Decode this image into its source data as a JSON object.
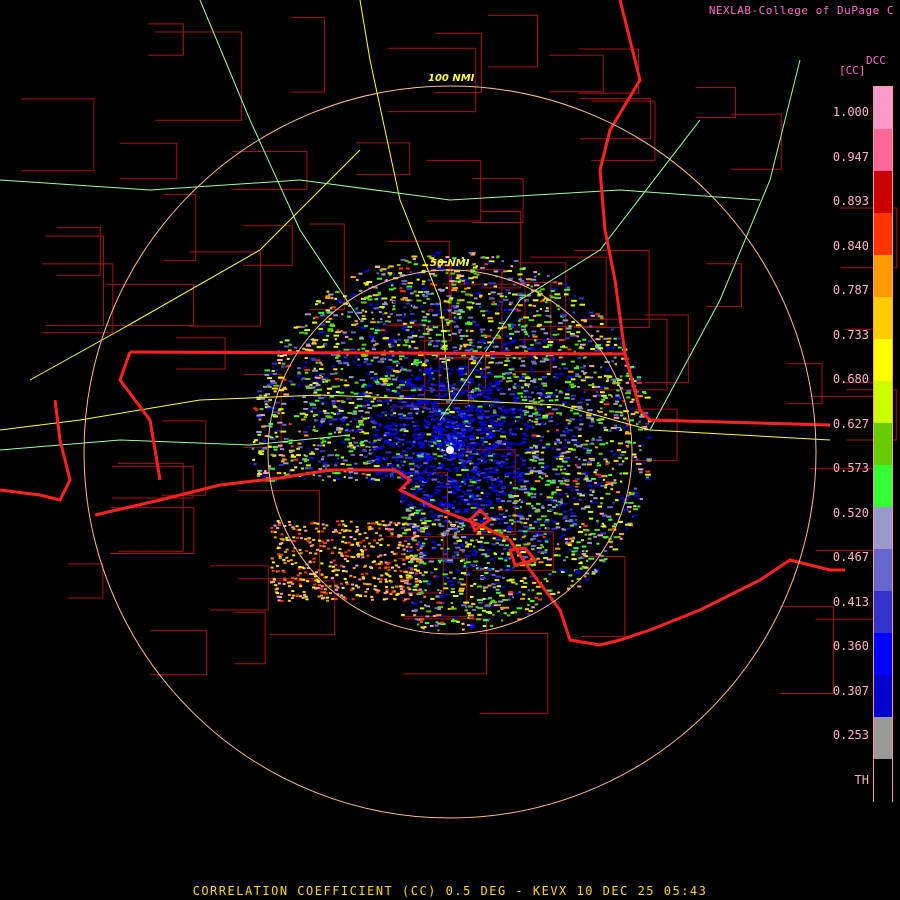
{
  "credit": "NEXLAB-College of DuPage C",
  "legend": {
    "source": "DCC",
    "unit": "[CC]",
    "ticks": [
      "1.000",
      "0.947",
      "0.893",
      "0.840",
      "0.787",
      "0.733",
      "0.680",
      "0.627",
      "0.573",
      "0.520",
      "0.467",
      "0.413",
      "0.360",
      "0.307",
      "0.253",
      "TH"
    ],
    "colors": [
      "#ff99cc",
      "#ff6699",
      "#cc0000",
      "#ff3300",
      "#ff9900",
      "#ffcc00",
      "#ffff00",
      "#ccff00",
      "#66cc00",
      "#33ff33",
      "#9999cc",
      "#6666cc",
      "#3333cc",
      "#0000ff",
      "#0000cc",
      "#999999",
      "#000000"
    ]
  },
  "rings": {
    "inner_label": "50 NMI",
    "outer_label": "100 NMI"
  },
  "footer": "CORRELATION COEFFICIENT (CC) 0.5 DEG - KEVX 10 DEC 25 05:43",
  "colors": {
    "state_border": "#ff2222",
    "county": "#aa1111",
    "highway_major": "#ffff33",
    "highway_minor": "#99ff99",
    "ring": "#ffbb88"
  }
}
